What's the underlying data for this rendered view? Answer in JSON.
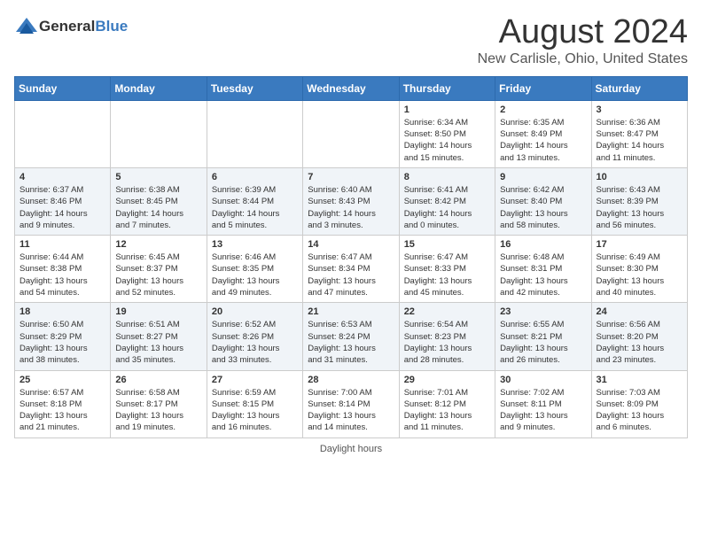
{
  "logo": {
    "general": "General",
    "blue": "Blue"
  },
  "title": "August 2024",
  "location": "New Carlisle, Ohio, United States",
  "days_of_week": [
    "Sunday",
    "Monday",
    "Tuesday",
    "Wednesday",
    "Thursday",
    "Friday",
    "Saturday"
  ],
  "footer": "Daylight hours",
  "weeks": [
    [
      {
        "day": "",
        "info": ""
      },
      {
        "day": "",
        "info": ""
      },
      {
        "day": "",
        "info": ""
      },
      {
        "day": "",
        "info": ""
      },
      {
        "day": "1",
        "info": "Sunrise: 6:34 AM\nSunset: 8:50 PM\nDaylight: 14 hours\nand 15 minutes."
      },
      {
        "day": "2",
        "info": "Sunrise: 6:35 AM\nSunset: 8:49 PM\nDaylight: 14 hours\nand 13 minutes."
      },
      {
        "day": "3",
        "info": "Sunrise: 6:36 AM\nSunset: 8:47 PM\nDaylight: 14 hours\nand 11 minutes."
      }
    ],
    [
      {
        "day": "4",
        "info": "Sunrise: 6:37 AM\nSunset: 8:46 PM\nDaylight: 14 hours\nand 9 minutes."
      },
      {
        "day": "5",
        "info": "Sunrise: 6:38 AM\nSunset: 8:45 PM\nDaylight: 14 hours\nand 7 minutes."
      },
      {
        "day": "6",
        "info": "Sunrise: 6:39 AM\nSunset: 8:44 PM\nDaylight: 14 hours\nand 5 minutes."
      },
      {
        "day": "7",
        "info": "Sunrise: 6:40 AM\nSunset: 8:43 PM\nDaylight: 14 hours\nand 3 minutes."
      },
      {
        "day": "8",
        "info": "Sunrise: 6:41 AM\nSunset: 8:42 PM\nDaylight: 14 hours\nand 0 minutes."
      },
      {
        "day": "9",
        "info": "Sunrise: 6:42 AM\nSunset: 8:40 PM\nDaylight: 13 hours\nand 58 minutes."
      },
      {
        "day": "10",
        "info": "Sunrise: 6:43 AM\nSunset: 8:39 PM\nDaylight: 13 hours\nand 56 minutes."
      }
    ],
    [
      {
        "day": "11",
        "info": "Sunrise: 6:44 AM\nSunset: 8:38 PM\nDaylight: 13 hours\nand 54 minutes."
      },
      {
        "day": "12",
        "info": "Sunrise: 6:45 AM\nSunset: 8:37 PM\nDaylight: 13 hours\nand 52 minutes."
      },
      {
        "day": "13",
        "info": "Sunrise: 6:46 AM\nSunset: 8:35 PM\nDaylight: 13 hours\nand 49 minutes."
      },
      {
        "day": "14",
        "info": "Sunrise: 6:47 AM\nSunset: 8:34 PM\nDaylight: 13 hours\nand 47 minutes."
      },
      {
        "day": "15",
        "info": "Sunrise: 6:47 AM\nSunset: 8:33 PM\nDaylight: 13 hours\nand 45 minutes."
      },
      {
        "day": "16",
        "info": "Sunrise: 6:48 AM\nSunset: 8:31 PM\nDaylight: 13 hours\nand 42 minutes."
      },
      {
        "day": "17",
        "info": "Sunrise: 6:49 AM\nSunset: 8:30 PM\nDaylight: 13 hours\nand 40 minutes."
      }
    ],
    [
      {
        "day": "18",
        "info": "Sunrise: 6:50 AM\nSunset: 8:29 PM\nDaylight: 13 hours\nand 38 minutes."
      },
      {
        "day": "19",
        "info": "Sunrise: 6:51 AM\nSunset: 8:27 PM\nDaylight: 13 hours\nand 35 minutes."
      },
      {
        "day": "20",
        "info": "Sunrise: 6:52 AM\nSunset: 8:26 PM\nDaylight: 13 hours\nand 33 minutes."
      },
      {
        "day": "21",
        "info": "Sunrise: 6:53 AM\nSunset: 8:24 PM\nDaylight: 13 hours\nand 31 minutes."
      },
      {
        "day": "22",
        "info": "Sunrise: 6:54 AM\nSunset: 8:23 PM\nDaylight: 13 hours\nand 28 minutes."
      },
      {
        "day": "23",
        "info": "Sunrise: 6:55 AM\nSunset: 8:21 PM\nDaylight: 13 hours\nand 26 minutes."
      },
      {
        "day": "24",
        "info": "Sunrise: 6:56 AM\nSunset: 8:20 PM\nDaylight: 13 hours\nand 23 minutes."
      }
    ],
    [
      {
        "day": "25",
        "info": "Sunrise: 6:57 AM\nSunset: 8:18 PM\nDaylight: 13 hours\nand 21 minutes."
      },
      {
        "day": "26",
        "info": "Sunrise: 6:58 AM\nSunset: 8:17 PM\nDaylight: 13 hours\nand 19 minutes."
      },
      {
        "day": "27",
        "info": "Sunrise: 6:59 AM\nSunset: 8:15 PM\nDaylight: 13 hours\nand 16 minutes."
      },
      {
        "day": "28",
        "info": "Sunrise: 7:00 AM\nSunset: 8:14 PM\nDaylight: 13 hours\nand 14 minutes."
      },
      {
        "day": "29",
        "info": "Sunrise: 7:01 AM\nSunset: 8:12 PM\nDaylight: 13 hours\nand 11 minutes."
      },
      {
        "day": "30",
        "info": "Sunrise: 7:02 AM\nSunset: 8:11 PM\nDaylight: 13 hours\nand 9 minutes."
      },
      {
        "day": "31",
        "info": "Sunrise: 7:03 AM\nSunset: 8:09 PM\nDaylight: 13 hours\nand 6 minutes."
      }
    ]
  ]
}
